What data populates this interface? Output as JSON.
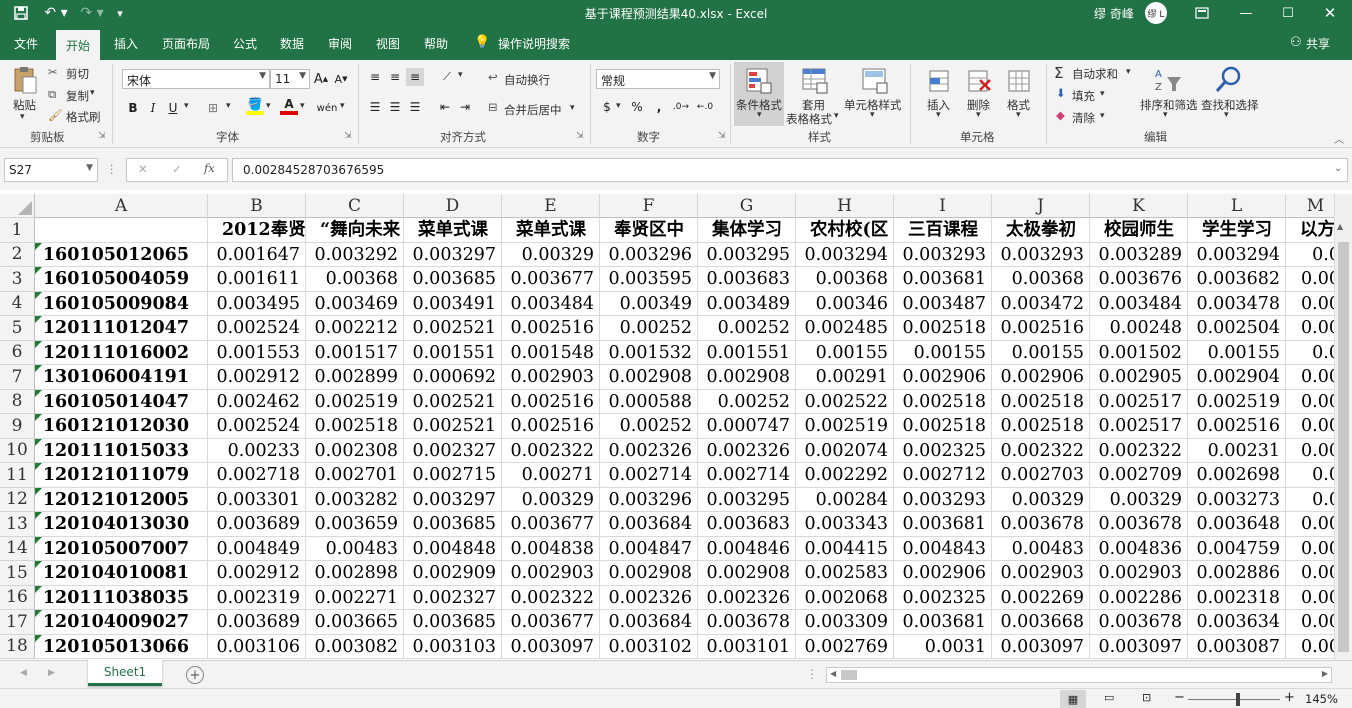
{
  "title": "基于课程预测结果40.xlsx  -  Excel",
  "user": {
    "name": "缪 奇峰",
    "initials": "缪 L"
  },
  "tabs": [
    "文件",
    "开始",
    "插入",
    "页面布局",
    "公式",
    "数据",
    "审阅",
    "视图",
    "帮助"
  ],
  "tell_me": "操作说明搜索",
  "share": "共享",
  "ribbon": {
    "clipboard": {
      "paste": "粘贴",
      "cut": "剪切",
      "copy": "复制",
      "painter": "格式刷",
      "group": "剪贴板"
    },
    "font": {
      "name": "宋体",
      "size": "11",
      "bold": "B",
      "italic": "I",
      "underline": "U",
      "grow": "A",
      "shrink": "A",
      "phonetic": "wén",
      "group": "字体"
    },
    "alignment": {
      "wrap": "自动换行",
      "merge": "合并后居中",
      "group": "对齐方式"
    },
    "number": {
      "format": "常规",
      "currency": "$",
      "percent": "%",
      "comma": ",",
      "group": "数字"
    },
    "styles": {
      "conditional": "条件格式",
      "table_line1": "套用",
      "table_line2": "表格格式",
      "cell_styles": "单元格样式",
      "group": "样式"
    },
    "cells": {
      "insert": "插入",
      "delete": "删除",
      "format": "格式",
      "group": "单元格"
    },
    "editing": {
      "autosum": "自动求和",
      "fill": "填充",
      "clear": "清除",
      "sort": "排序和筛选",
      "find": "查找和选择",
      "group": "编辑"
    }
  },
  "formula_bar": {
    "cell_ref": "S27",
    "fx": "fx",
    "value": "0.00284528703676595"
  },
  "columns": [
    "A",
    "B",
    "C",
    "D",
    "E",
    "F",
    "G",
    "H",
    "I",
    "J",
    "K",
    "L",
    "M"
  ],
  "header_row": [
    "",
    "2012奉贤",
    "“舞向未来",
    "菜单式课",
    "菜单式课",
    "奉贤区中",
    "集体学习",
    "农村校(区",
    "三百课程",
    "太极拳初",
    "校园师生",
    "学生学习",
    "以方"
  ],
  "rows": [
    [
      "160105012065",
      "0.001647",
      "0.003292",
      "0.003297",
      "0.00329",
      "0.003296",
      "0.003295",
      "0.003294",
      "0.003293",
      "0.003293",
      "0.003289",
      "0.003294",
      "0.0"
    ],
    [
      "160105004059",
      "0.001611",
      "0.00368",
      "0.003685",
      "0.003677",
      "0.003595",
      "0.003683",
      "0.00368",
      "0.003681",
      "0.00368",
      "0.003676",
      "0.003682",
      "0.00"
    ],
    [
      "160105009084",
      "0.003495",
      "0.003469",
      "0.003491",
      "0.003484",
      "0.00349",
      "0.003489",
      "0.00346",
      "0.003487",
      "0.003472",
      "0.003484",
      "0.003478",
      "0.00"
    ],
    [
      "120111012047",
      "0.002524",
      "0.002212",
      "0.002521",
      "0.002516",
      "0.00252",
      "0.00252",
      "0.002485",
      "0.002518",
      "0.002516",
      "0.00248",
      "0.002504",
      "0.00"
    ],
    [
      "120111016002",
      "0.001553",
      "0.001517",
      "0.001551",
      "0.001548",
      "0.001532",
      "0.001551",
      "0.00155",
      "0.00155",
      "0.00155",
      "0.001502",
      "0.00155",
      "0.0"
    ],
    [
      "130106004191",
      "0.002912",
      "0.002899",
      "0.000692",
      "0.002903",
      "0.002908",
      "0.002908",
      "0.00291",
      "0.002906",
      "0.002906",
      "0.002905",
      "0.002904",
      "0.00"
    ],
    [
      "160105014047",
      "0.002462",
      "0.002519",
      "0.002521",
      "0.002516",
      "0.000588",
      "0.00252",
      "0.002522",
      "0.002518",
      "0.002518",
      "0.002517",
      "0.002519",
      "0.00"
    ],
    [
      "160121012030",
      "0.002524",
      "0.002518",
      "0.002521",
      "0.002516",
      "0.00252",
      "0.000747",
      "0.002519",
      "0.002518",
      "0.002518",
      "0.002517",
      "0.002516",
      "0.00"
    ],
    [
      "120111015033",
      "0.00233",
      "0.002308",
      "0.002327",
      "0.002322",
      "0.002326",
      "0.002326",
      "0.002074",
      "0.002325",
      "0.002322",
      "0.002322",
      "0.00231",
      "0.00"
    ],
    [
      "120121011079",
      "0.002718",
      "0.002701",
      "0.002715",
      "0.00271",
      "0.002714",
      "0.002714",
      "0.002292",
      "0.002712",
      "0.002703",
      "0.002709",
      "0.002698",
      "0.0"
    ],
    [
      "120121012005",
      "0.003301",
      "0.003282",
      "0.003297",
      "0.00329",
      "0.003296",
      "0.003295",
      "0.00284",
      "0.003293",
      "0.00329",
      "0.00329",
      "0.003273",
      "0.0"
    ],
    [
      "120104013030",
      "0.003689",
      "0.003659",
      "0.003685",
      "0.003677",
      "0.003684",
      "0.003683",
      "0.003343",
      "0.003681",
      "0.003678",
      "0.003678",
      "0.003648",
      "0.00"
    ],
    [
      "120105007007",
      "0.004849",
      "0.00483",
      "0.004848",
      "0.004838",
      "0.004847",
      "0.004846",
      "0.004415",
      "0.004843",
      "0.00483",
      "0.004836",
      "0.004759",
      "0.00"
    ],
    [
      "120104010081",
      "0.002912",
      "0.002898",
      "0.002909",
      "0.002903",
      "0.002908",
      "0.002908",
      "0.002583",
      "0.002906",
      "0.002903",
      "0.002903",
      "0.002886",
      "0.00"
    ],
    [
      "120111038035",
      "0.002319",
      "0.002271",
      "0.002327",
      "0.002322",
      "0.002326",
      "0.002326",
      "0.002068",
      "0.002325",
      "0.002269",
      "0.002286",
      "0.002318",
      "0.00"
    ],
    [
      "120104009027",
      "0.003689",
      "0.003665",
      "0.003685",
      "0.003677",
      "0.003684",
      "0.003678",
      "0.003309",
      "0.003681",
      "0.003668",
      "0.003678",
      "0.003634",
      "0.00"
    ],
    [
      "120105013066",
      "0.003106",
      "0.003082",
      "0.003103",
      "0.003097",
      "0.003102",
      "0.003101",
      "0.002769",
      "0.0031",
      "0.003097",
      "0.003097",
      "0.003087",
      "0.00"
    ]
  ],
  "sheet_tab": "Sheet1",
  "add_sheet": "+",
  "zoom": "145%",
  "zoom_minus": "−",
  "zoom_plus": "+"
}
